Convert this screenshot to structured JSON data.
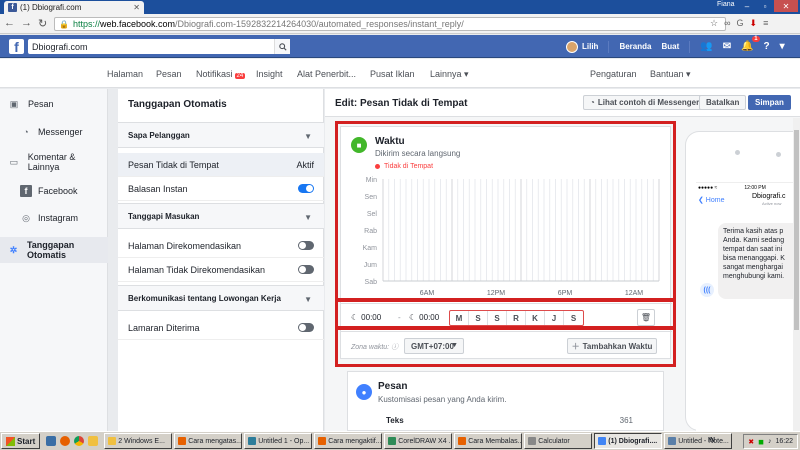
{
  "browser": {
    "tab_title": "(1) Dbiografi.com",
    "profile": "Fiana",
    "url_https": "https://",
    "url_host": "web.facebook.com",
    "url_path": "/Dbiografi.com-1592832214264030/automated_responses/instant_reply/"
  },
  "fb": {
    "logo": "f",
    "search_value": "Dbiografi.com",
    "user": "Lilih",
    "home": "Beranda",
    "create": "Buat",
    "notif_badge": "1"
  },
  "pagenav": {
    "items": [
      "Halaman",
      "Pesan",
      "Notifikasi",
      "Insight",
      "Alat Penerbit...",
      "Pusat Iklan",
      "Lainnya ▾"
    ],
    "notif_badge": "24",
    "settings": "Pengaturan",
    "help": "Bantuan ▾"
  },
  "sidebar": {
    "items": [
      {
        "label": "Pesan",
        "icon": "inbox-icon"
      },
      {
        "label": "Messenger",
        "icon": "messenger-icon"
      },
      {
        "label": "Komentar & Lainnya",
        "icon": "comment-icon"
      },
      {
        "label": "Facebook",
        "icon": "facebook-icon"
      },
      {
        "label": "Instagram",
        "icon": "instagram-icon"
      },
      {
        "label": "Tanggapan Otomatis",
        "icon": "automation-icon"
      }
    ]
  },
  "mid": {
    "title": "Tanggapan Otomatis",
    "sections": [
      {
        "label": "Sapa Pelanggan"
      },
      {
        "label": "Tanggapi Masukan"
      },
      {
        "label": "Berkomunikasi tentang Lowongan Kerja"
      }
    ],
    "rows": [
      {
        "label": "Pesan Tidak di Tempat",
        "status": "Aktif"
      },
      {
        "label": "Balasan Instan"
      },
      {
        "label": "Halaman Direkomendasikan"
      },
      {
        "label": "Halaman Tidak Direkomendasikan"
      },
      {
        "label": "Lamaran Diterima"
      }
    ]
  },
  "main": {
    "title": "Edit: Pesan Tidak di Tempat",
    "preview_btn": "Lihat contoh di Messenger",
    "cancel_btn": "Batalkan",
    "save_btn": "Simpan"
  },
  "schedule": {
    "title": "Waktu",
    "subtitle": "Dikirim secara langsung",
    "legend": "Tidak di Tempat",
    "days": [
      "Min",
      "Sen",
      "Sel",
      "Rab",
      "Kam",
      "Jum",
      "Sab"
    ],
    "hour_labels": [
      "6AM",
      "12PM",
      "6PM",
      "12AM"
    ],
    "start_time": "00:00",
    "end_time": "00:00",
    "separator": "-",
    "day_buttons": [
      "M",
      "S",
      "S",
      "R",
      "K",
      "J",
      "S"
    ],
    "tz_label": "Zona waktu:",
    "tz_value": "GMT+07:00",
    "add_time": "Tambahkan Waktu"
  },
  "pesan": {
    "title": "Pesan",
    "subtitle": "Kustomisasi pesan yang Anda kirim.",
    "teks_label": "Teks",
    "teks_count": "361"
  },
  "phone": {
    "time": "12:00 PM",
    "carrier": "●●●●● ≈",
    "battery": "▬",
    "back": "❮ Home",
    "page_name": "Dbiografi.c",
    "active": "Active now",
    "bubble": "Terima kasih atas p\nAnda. Kami sedang\ntempat dan saat ini\nbisa menanggapi. K\nsangat menghargai\nmenghubungi kami.",
    "avatar": "((("
  },
  "taskbar": {
    "start": "Start",
    "tasks": [
      "2 Windows E...",
      "Cara mengatas...",
      "Untitled 1 - Op...",
      "Cara mengaktif...",
      "CorelDRAW X4 ...",
      "Cara Membalas...",
      "Calculator",
      "(1) Dbiografi....",
      "Untitled - Note..."
    ],
    "active_index": 7,
    "lang": "IN",
    "clock": "16:22"
  },
  "colors": {
    "fb_blue": "#4267b2",
    "highlight_red": "#d32020",
    "toggle_on": "#1877f2",
    "away_red": "#fa3e3e"
  }
}
